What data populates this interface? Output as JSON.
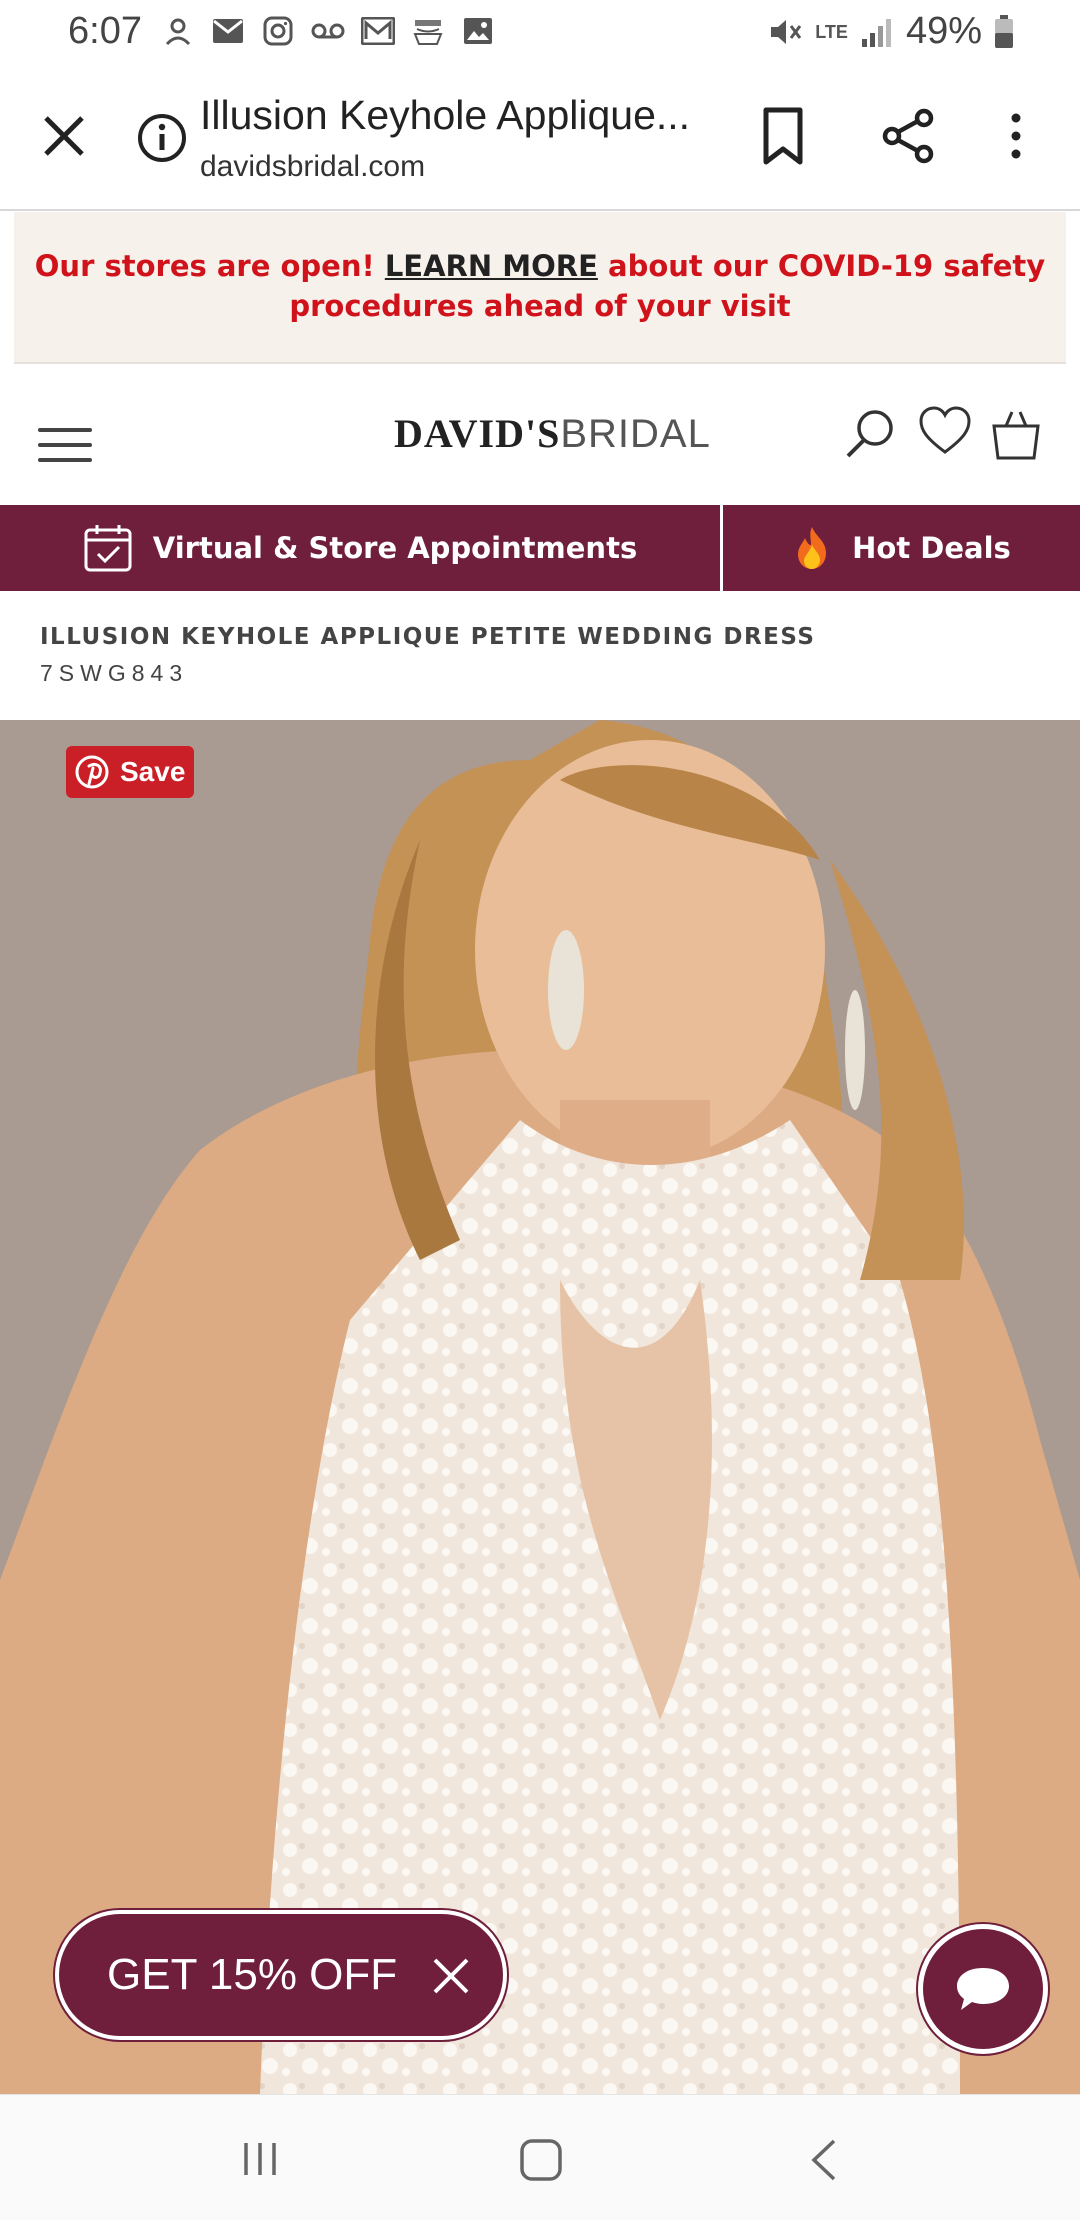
{
  "status_bar": {
    "time": "6:07",
    "battery": "49%",
    "network": "LTE",
    "notification_icons": [
      "amazon-assistant-icon",
      "gmail-icon",
      "instagram-icon",
      "voicemail-icon",
      "mail-icon",
      "amazon-icon",
      "gallery-icon"
    ]
  },
  "browser": {
    "page_title": "Illusion Keyhole Applique...",
    "domain": "davidsbridal.com"
  },
  "banner": {
    "text_before": "Our stores are open! ",
    "link": "LEARN MORE",
    "text_after": " about our COVID-19 safety procedures ahead of your visit"
  },
  "header": {
    "logo_part1": "DAVID'S",
    "logo_part2": "BRIDAL"
  },
  "actions": {
    "appointments": "Virtual & Store Appointments",
    "deals": "Hot Deals"
  },
  "product": {
    "title": "ILLUSION KEYHOLE APPLIQUE PETITE WEDDING DRESS",
    "sku": "7SWG843"
  },
  "pinterest": {
    "label": "Save"
  },
  "promo": {
    "label": "GET 15% OFF"
  },
  "colors": {
    "brand": "#6f1f3b",
    "banner_red": "#d0121b",
    "pinterest_red": "#cb1f27",
    "photo_bg": "#a99a92"
  }
}
